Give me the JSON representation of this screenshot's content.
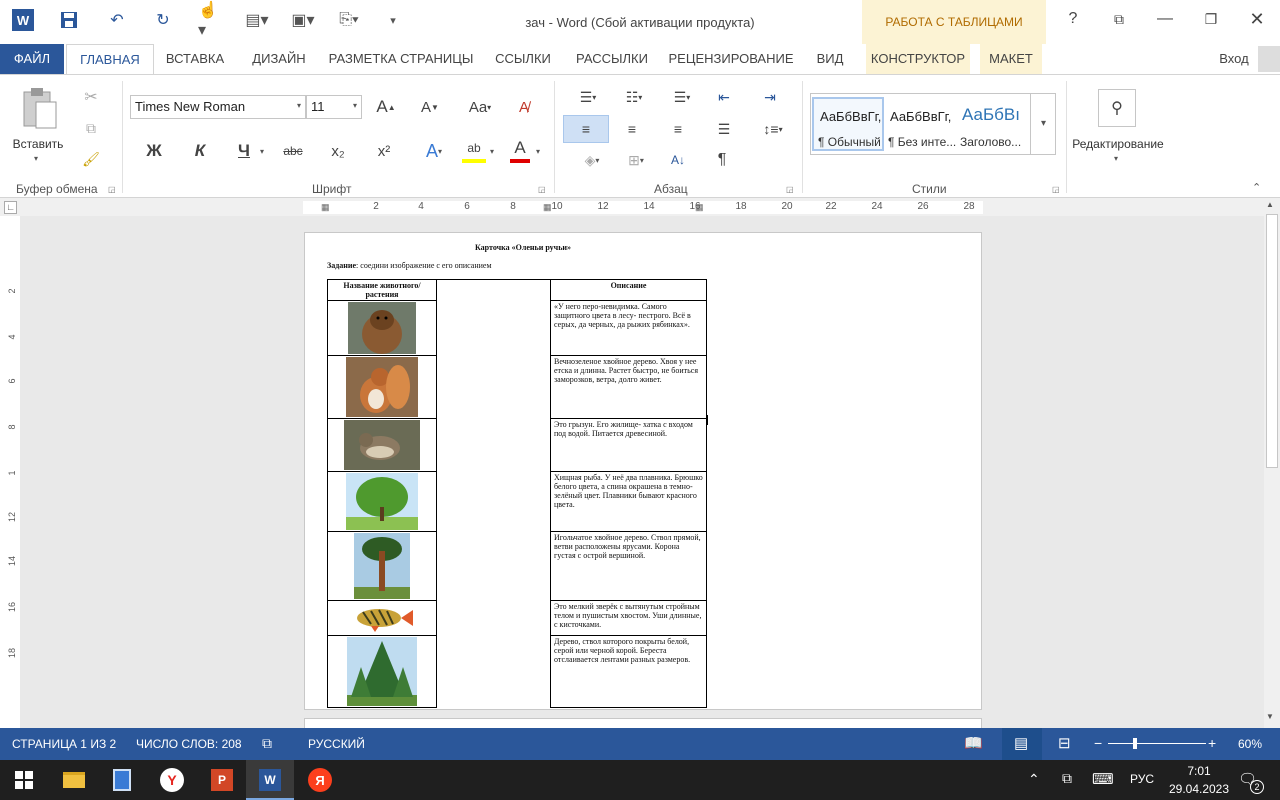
{
  "window": {
    "title": "зач - Word (Сбой активации продукта)",
    "contextual_group": "РАБОТА С ТАБЛИЦАМИ",
    "help": "?",
    "signin": "Вход"
  },
  "tabs": [
    "ФАЙЛ",
    "ГЛАВНАЯ",
    "ВСТАВКА",
    "ДИЗАЙН",
    "РАЗМЕТКА СТРАНИЦЫ",
    "ССЫЛКИ",
    "РАССЫЛКИ",
    "РЕЦЕНЗИРОВАНИЕ",
    "ВИД",
    "КОНСТРУКТОР",
    "МАКЕТ"
  ],
  "ribbon": {
    "clipboard": {
      "paste_label": "Вставить",
      "group_label": "Буфер обмена"
    },
    "font": {
      "name": "Times New Roman",
      "size": "11",
      "group_label": "Шрифт",
      "bold": "Ж",
      "italic": "К",
      "underline": "Ч",
      "strike": "abc",
      "sub": "x₂",
      "sup": "x²",
      "grow": "A",
      "shrink": "A",
      "case": "Aa"
    },
    "paragraph": {
      "group_label": "Абзац",
      "pilcrow": "¶"
    },
    "styles": {
      "group_label": "Стили",
      "items": [
        {
          "preview": "АаБбВвГг,",
          "name": "¶ Обычный"
        },
        {
          "preview": "АаБбВвГг,",
          "name": "¶ Без инте..."
        },
        {
          "preview": "АаБбВı",
          "name": "Заголово..."
        }
      ]
    },
    "editing": {
      "label": "Редактирование"
    }
  },
  "ruler": {
    "h_numbers": [
      "2",
      "4",
      "6",
      "8",
      "10",
      "12",
      "14",
      "16",
      "18",
      "20",
      "22",
      "24",
      "26",
      "28"
    ],
    "v_numbers": [
      "2",
      "4",
      "6",
      "8",
      "1",
      "12",
      "14",
      "16",
      "18"
    ]
  },
  "document": {
    "title": "Карточка «Оленьи ручьи»",
    "task_label": "Задание",
    "task_text": ": соедини изображение с его описанием",
    "col_name_header": "Название животного/растения",
    "col_desc_header": "Описание",
    "rows": [
      {
        "picture": "beaver",
        "desc": "«У него перо-невидимка. Самого защитного цвета в лесу- пестрого. Всё в серых, да черных, да рыжих рябинках»."
      },
      {
        "picture": "squirrel",
        "desc": "Вечнозеленое хвойное дерево. Хвоя у нее етска и длинна. Растет быстро, не боиться заморозков, ветра, долго живет."
      },
      {
        "picture": "thrush",
        "desc": "Это грызун. Его жилище- хатка с входом под водой. Питается древесиной."
      },
      {
        "picture": "birch",
        "desc": "Хищная рыба. У неё два плавника. Брюшко белого цвета, а спина окрашена в темно-зелёный цвет. Плавники бывают красного цвета."
      },
      {
        "picture": "pine",
        "desc": "Игольчатое хвойное дерево. Ствол прямой, ветви расположены ярусами. Корона густая с острой вершиной."
      },
      {
        "picture": "perch",
        "desc": "Это мелкий зверёк с вытянутым стройным телом и пушистым хвостом. Уши длинные, с кисточками."
      },
      {
        "picture": "spruce",
        "desc": "Дерево, ствол которого покрыты белой, серой или черной корой. Береста отслаивается лентами разных размеров."
      }
    ]
  },
  "status": {
    "page": "СТРАНИЦА 1 ИЗ 2",
    "words": "ЧИСЛО СЛОВ: 208",
    "lang": "РУССКИЙ",
    "zoom": "60%",
    "zoom_value": 60
  },
  "taskbar": {
    "lang": "РУС",
    "time": "7:01",
    "date": "29.04.2023",
    "notifications": "2"
  },
  "colors": {
    "word_blue": "#2b579a",
    "table_tools": "#fcf3d4"
  }
}
